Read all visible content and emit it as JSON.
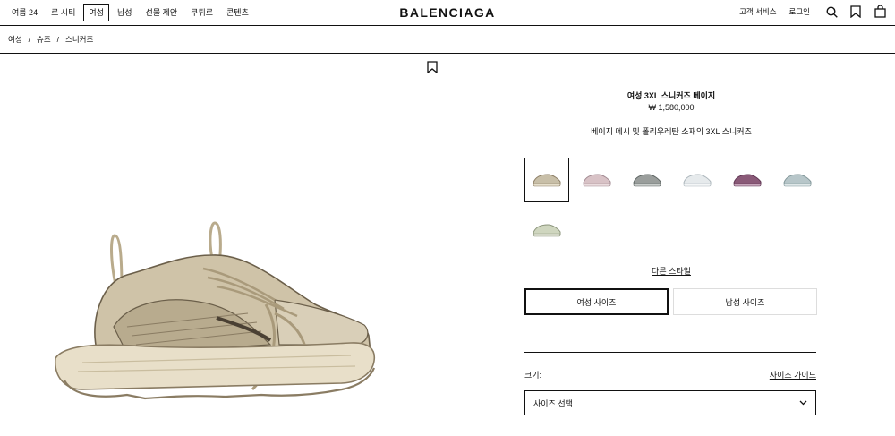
{
  "nav": {
    "items": [
      {
        "label": "여름 24",
        "active": false
      },
      {
        "label": "르 시티",
        "active": false
      },
      {
        "label": "여성",
        "active": true
      },
      {
        "label": "남성",
        "active": false
      },
      {
        "label": "선물 제안",
        "active": false
      },
      {
        "label": "쿠튀르",
        "active": false
      },
      {
        "label": "콘텐츠",
        "active": false
      }
    ]
  },
  "brand": "BALENCIAGA",
  "header_right": {
    "customer_service": "고객 서비스",
    "login": "로그인",
    "icons": [
      "search-icon",
      "bookmark-icon",
      "shopping-bag-icon"
    ]
  },
  "breadcrumb": [
    "여성",
    "슈즈",
    "스니커즈"
  ],
  "breadcrumb_separator": "/",
  "product": {
    "name": "여성 3XL 스니커즈 베이지",
    "price": "₩ 1,580,000",
    "description": "베이지 메시 및 폴리우레탄 소재의 3XL 스니커즈",
    "swatches": [
      {
        "color": "#c8bfa8",
        "accent": "#8a7c63",
        "active": true
      },
      {
        "color": "#d8c2c6",
        "accent": "#a08890",
        "active": false
      },
      {
        "color": "#9a9e9c",
        "accent": "#5c6462",
        "active": false
      },
      {
        "color": "#e6eaec",
        "accent": "#aab4ba",
        "active": false
      },
      {
        "color": "#8a5a78",
        "accent": "#5e3552",
        "active": false
      },
      {
        "color": "#b7c6c9",
        "accent": "#7f9497",
        "active": false
      },
      {
        "color": "#cfd6bf",
        "accent": "#8c957c",
        "active": false
      }
    ],
    "other_style": "다른 스타일",
    "size_tabs": [
      {
        "label": "여성 사이즈",
        "active": true
      },
      {
        "label": "남성 사이즈",
        "active": false
      }
    ],
    "size_label": "크기:",
    "size_guide": "사이즈 가이드",
    "size_select_placeholder": "사이즈 선택"
  },
  "colors": {
    "text": "#111111",
    "shoe_main": "#cfc3a8",
    "shoe_dark": "#6b5f4a",
    "sole": "#e8dfc9"
  }
}
